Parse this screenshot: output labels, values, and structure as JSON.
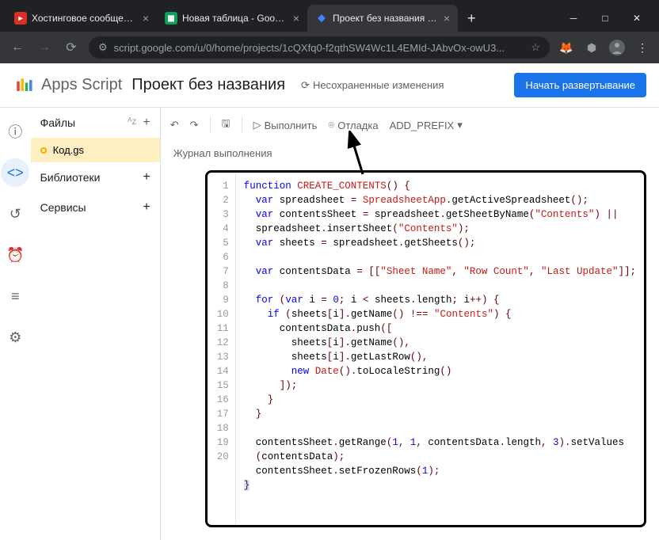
{
  "browser": {
    "tabs": [
      {
        "title": "Хостинговое сообщество",
        "icon_bg": "#d93025",
        "icon_txt": "▶",
        "active": false
      },
      {
        "title": "Новая таблица - Google Та",
        "icon_bg": "#0f9d58",
        "icon_txt": "▦",
        "active": false
      },
      {
        "title": "Проект без названия - Ред",
        "icon_bg": "#4285f4",
        "icon_txt": "◆",
        "active": true
      }
    ],
    "url": "script.google.com/u/0/home/projects/1cQXfq0-f2qthSW4Wc1L4EMId-JAbvOx-owU3..."
  },
  "header": {
    "app_name": "Apps Script",
    "project_title": "Проект без названия",
    "save_status": "Несохраненные изменения",
    "deploy_btn": "Начать развертывание"
  },
  "file_panel": {
    "files_label": "Файлы",
    "libraries_label": "Библиотеки",
    "services_label": "Сервисы",
    "file_name": "Код.gs"
  },
  "toolbar": {
    "run_label": "Выполнить",
    "debug_label": "Отладка",
    "function_select": "ADD_PREFIX",
    "log_label": "Журнал выполнения"
  },
  "code_lines": [
    1,
    2,
    3,
    4,
    5,
    6,
    7,
    8,
    9,
    10,
    11,
    12,
    13,
    14,
    15,
    16,
    17,
    18,
    19,
    20
  ]
}
